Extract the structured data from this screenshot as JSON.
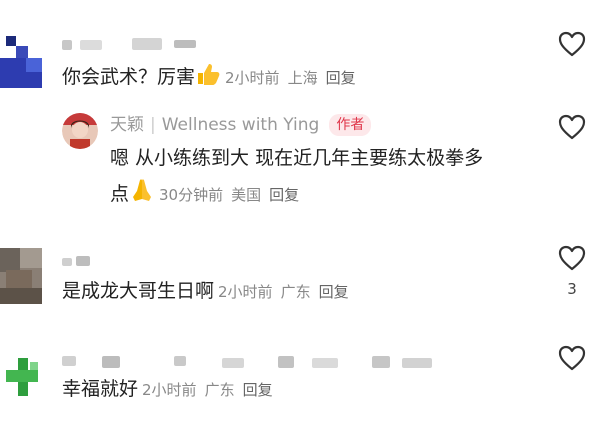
{
  "comments": [
    {
      "text": "你会武术？厉害",
      "emoji": "thumbs-up-icon",
      "time": "2小时前",
      "location": "上海",
      "reply_label": "回复"
    },
    {
      "author_name": "天颖",
      "channel_name": "Wellness with Ying",
      "author_badge": "作者",
      "text_line1": "嗯 从小练练到大 现在近几年主要练太极拳多",
      "text_line2": "点",
      "emoji": "praying-hands-icon",
      "time": "30分钟前",
      "location": "美国",
      "reply_label": "回复"
    },
    {
      "text": "是成龙大哥生日啊",
      "time": "2小时前",
      "location": "广东",
      "reply_label": "回复",
      "likes": "3"
    },
    {
      "text": "幸福就好",
      "time": "2小时前",
      "location": "广东",
      "reply_label": "回复"
    }
  ],
  "colors": {
    "accent": "#e0374b",
    "meta": "#888888",
    "text": "#222222"
  }
}
